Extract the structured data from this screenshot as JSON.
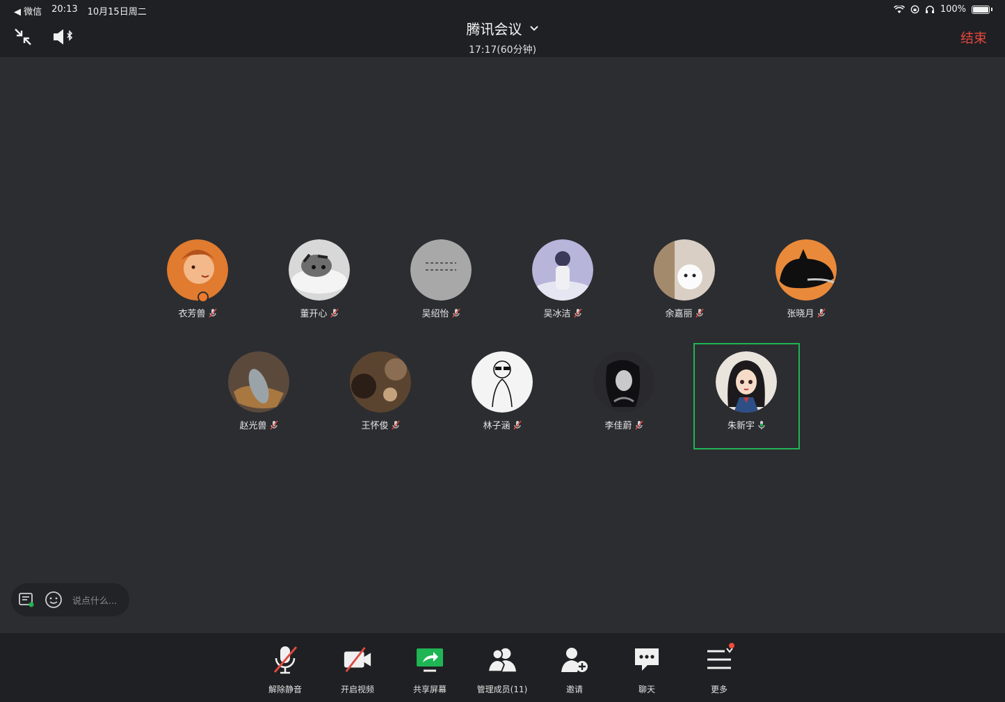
{
  "status": {
    "back_app": "◀ 微信",
    "time": "20:13",
    "date": "10月15日周二",
    "battery": "100%"
  },
  "meeting": {
    "title": "腾讯会议",
    "duration": "17:17(60分钟)",
    "end_label": "结束"
  },
  "participants": [
    {
      "name": "衣芳兽",
      "muted": true,
      "host": true,
      "avatar_color": "#e07b2f"
    },
    {
      "name": "董开心",
      "muted": true,
      "avatar_color": "#d8d8d8"
    },
    {
      "name": "吴绍怡",
      "muted": true,
      "avatar_color": "#a8a8a8"
    },
    {
      "name": "吴冰洁",
      "muted": true,
      "avatar_color": "#b7b5da"
    },
    {
      "name": "余嘉丽",
      "muted": true,
      "avatar_color": "#d9cfc4"
    },
    {
      "name": "张晓月",
      "muted": true,
      "avatar_color": "#e98a3a"
    },
    {
      "name": "赵光兽",
      "muted": true,
      "avatar_color": "#5b4a3c"
    },
    {
      "name": "王怀俊",
      "muted": true,
      "avatar_color": "#5a4430"
    },
    {
      "name": "林子涵",
      "muted": true,
      "avatar_color": "#f4f4f4"
    },
    {
      "name": "李佳蔚",
      "muted": true,
      "avatar_color": "#2a2a2e"
    },
    {
      "name": "朱新宇",
      "muted": false,
      "speaking": true,
      "avatar_color": "#e9e4dc"
    }
  ],
  "chat": {
    "placeholder": "说点什么..."
  },
  "toolbar": {
    "items": [
      {
        "label": "解除静音"
      },
      {
        "label": "开启视频"
      },
      {
        "label": "共享屏幕"
      },
      {
        "label": "管理成员(11)"
      },
      {
        "label": "邀请"
      },
      {
        "label": "聊天"
      },
      {
        "label": "更多"
      }
    ]
  },
  "colors": {
    "accent_green": "#1fb554",
    "end_red": "#e5473f",
    "mute_red": "#e04a40"
  }
}
